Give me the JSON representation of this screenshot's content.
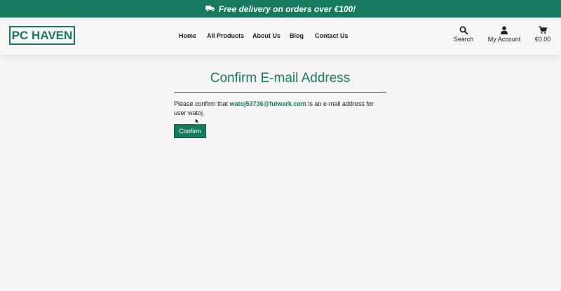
{
  "banner": {
    "text": "Free delivery on orders over €100!",
    "icon": "truck-icon"
  },
  "header": {
    "logo": "PC HAVEN",
    "nav": [
      "Home",
      "All Products",
      "About Us",
      "Blog",
      "Contact Us"
    ],
    "search_label": "Search",
    "account_label": "My Account",
    "cart_total": "€0.00"
  },
  "main": {
    "title": "Confirm E-mail Address",
    "msg_prefix": "Please confirm that ",
    "email": "watoj53736@fulwark.com",
    "msg_suffix": " is an e-mail address for user watoj.",
    "confirm_label": "Confirm"
  },
  "colors": {
    "brand": "#167a61",
    "background": "#f6f4f5"
  }
}
